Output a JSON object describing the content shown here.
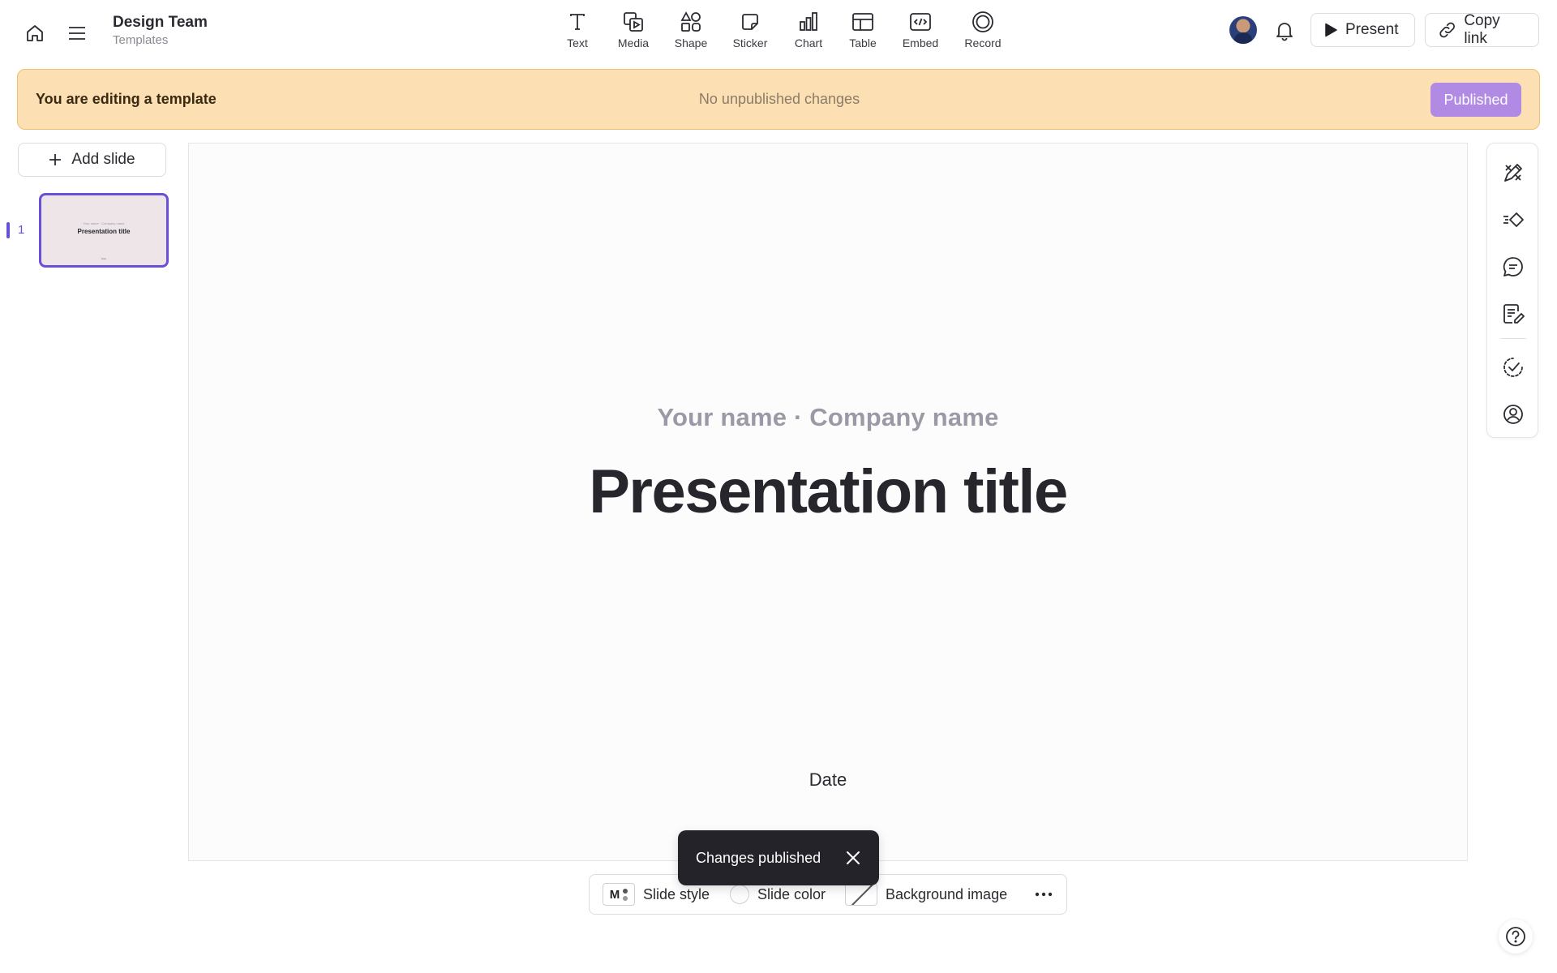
{
  "header": {
    "workspace_name": "Design Team",
    "workspace_sub": "Templates",
    "tools": [
      {
        "label": "Text",
        "icon": "text-icon"
      },
      {
        "label": "Media",
        "icon": "media-icon"
      },
      {
        "label": "Shape",
        "icon": "shape-icon"
      },
      {
        "label": "Sticker",
        "icon": "sticker-icon"
      },
      {
        "label": "Chart",
        "icon": "chart-icon"
      },
      {
        "label": "Table",
        "icon": "table-icon"
      },
      {
        "label": "Embed",
        "icon": "embed-icon"
      },
      {
        "label": "Record",
        "icon": "record-icon"
      }
    ],
    "present_label": "Present",
    "copy_link_label": "Copy link"
  },
  "banner": {
    "message": "You are editing a template",
    "status": "No unpublished changes",
    "published_label": "Published",
    "bg_color": "#fcdfb2",
    "accent_color": "#b08ae3"
  },
  "slides": {
    "add_label": "Add slide",
    "items": [
      {
        "number": "1",
        "sub": "Your name · Company name",
        "title": "Presentation title",
        "date": "Date"
      }
    ]
  },
  "canvas": {
    "subtitle": "Your name · Company name",
    "title": "Presentation title",
    "date": "Date"
  },
  "right_panel": {
    "icons": [
      "design-tools-icon",
      "animate-icon",
      "comment-icon",
      "notes-icon",
      "check-circle-icon",
      "user-circle-icon"
    ]
  },
  "bottom_bar": {
    "style_badge": "M",
    "slide_style_label": "Slide style",
    "slide_color_label": "Slide color",
    "background_image_label": "Background image"
  },
  "toast": {
    "message": "Changes published"
  },
  "colors": {
    "brand": "#6a4fd8",
    "toast_bg": "#232329"
  }
}
